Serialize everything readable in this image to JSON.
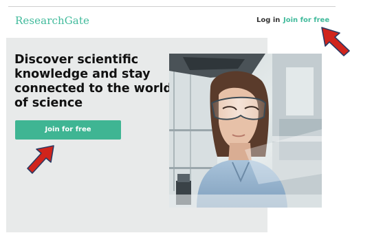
{
  "header": {
    "logo": "ResearchGate",
    "login_label": "Log in",
    "join_label": "Join for free"
  },
  "hero": {
    "title_lines": [
      "Discover scientific",
      "knowledge and stay",
      "connected to the world",
      "of science"
    ],
    "cta_label": "Join for free"
  },
  "colors": {
    "brand_green": "#40ba9b",
    "hero_background": "#e8eaea",
    "annotation_arrow": "#d0241c"
  },
  "icons": {
    "annotation_arrow_join_header": "red-arrow-icon",
    "annotation_arrow_join_cta": "red-arrow-icon"
  }
}
